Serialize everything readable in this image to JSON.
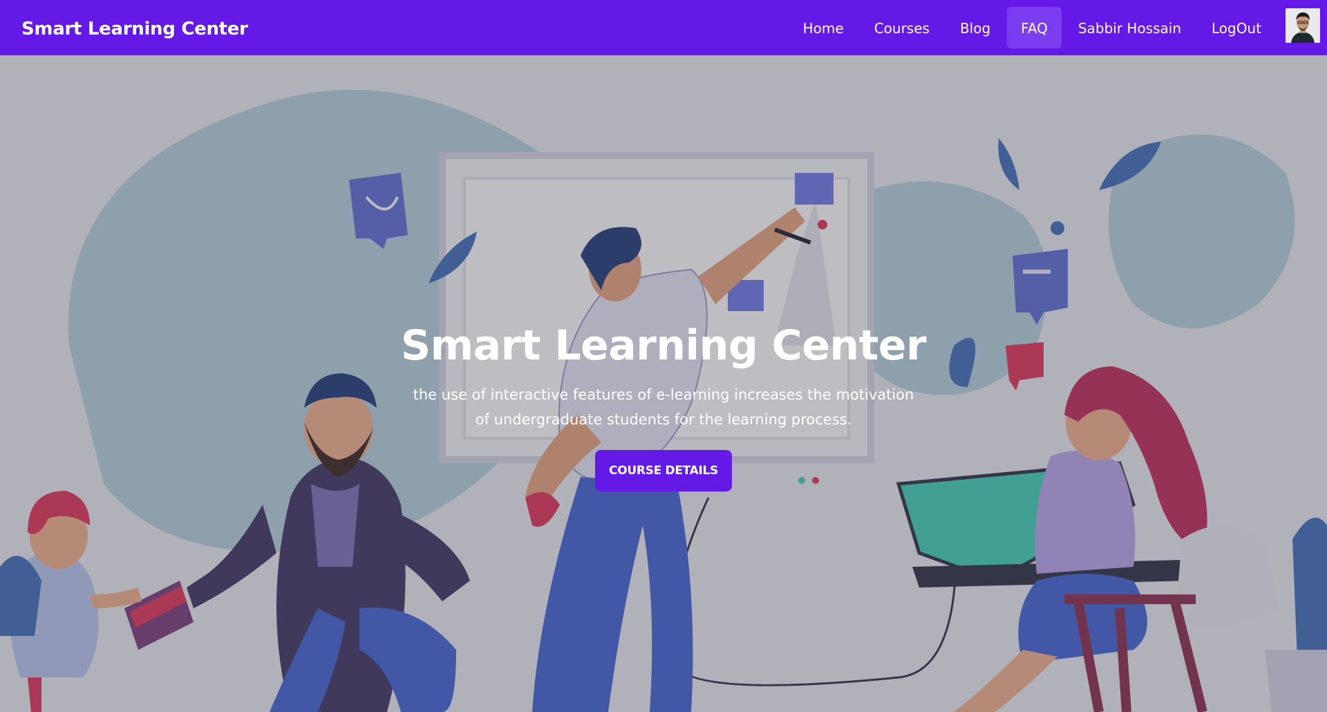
{
  "navbar": {
    "brand": "Smart Learning Center",
    "items": [
      {
        "label": "Home"
      },
      {
        "label": "Courses"
      },
      {
        "label": "Blog"
      },
      {
        "label": "FAQ"
      },
      {
        "label": "Sabbir Hossain"
      },
      {
        "label": "LogOut"
      }
    ],
    "active": "FAQ",
    "avatar_icon": "user-avatar"
  },
  "hero": {
    "title": "Smart Learning Center",
    "description": "the use of interactive features of e-learning increases the motivation of undergraduate students for the learning process.",
    "button_label": "COURSE DETAILS",
    "illustration": "people-learning-illustration"
  },
  "colors": {
    "primary": "#6419e6",
    "overlay": "#5a5a66"
  }
}
